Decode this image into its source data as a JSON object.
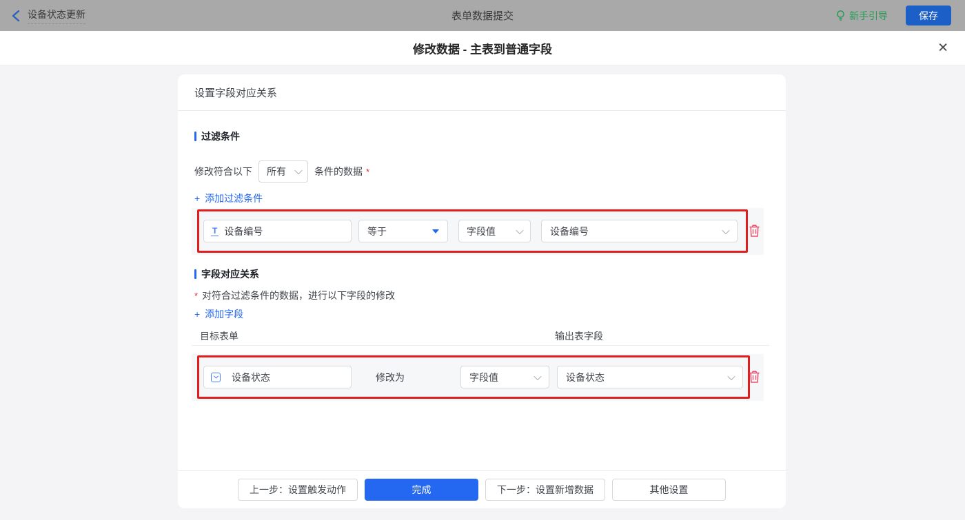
{
  "topbar": {
    "back_label": "设备状态更新",
    "center_title": "表单数据提交",
    "guide_label": "新手引导",
    "save_label": "保存"
  },
  "modal": {
    "title": "修改数据 - 主表到普通字段",
    "close_glyph": "✕"
  },
  "icons": {
    "plus": "+",
    "text_field_glyph": "T"
  },
  "panel": {
    "header": "设置字段对应关系",
    "filter_section": {
      "title": "过滤条件",
      "condition_prefix": "修改符合以下",
      "condition_select": "所有",
      "condition_suffix": "条件的数据",
      "required_mark": "*",
      "add_label": "添加过滤条件",
      "row": {
        "field": "设备编号",
        "operator": "等于",
        "value_type": "字段值",
        "value_field": "设备编号"
      }
    },
    "mapping_section": {
      "title": "字段对应关系",
      "required_mark": "*",
      "note": "对符合过滤条件的数据，进行以下字段的修改",
      "add_label": "添加字段",
      "col_target": "目标表单",
      "col_output": "输出表字段",
      "row": {
        "field": "设备状态",
        "action_label": "修改为",
        "value_type": "字段值",
        "value_field": "设备状态"
      }
    },
    "footer": {
      "prev": "上一步：设置触发动作",
      "done": "完成",
      "next": "下一步：设置新增数据",
      "other": "其他设置"
    }
  },
  "colors": {
    "accent_blue": "#2468f2",
    "highlight_red": "#e21d1d",
    "trash_red": "#f0506e",
    "guide_green": "#279b55",
    "topbar_dimmed": "#a9a9a9",
    "page_bg": "#f4f4f6"
  }
}
